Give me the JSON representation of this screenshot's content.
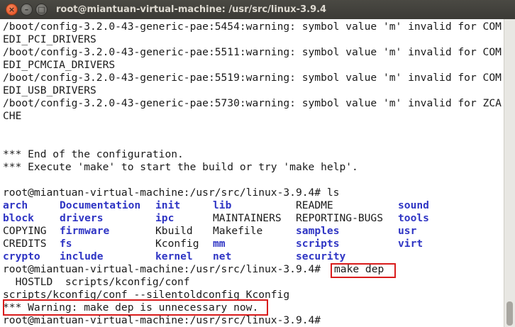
{
  "window": {
    "title": "root@miantuan-virtual-machine: /usr/src/linux-3.9.4",
    "close_glyph": "×",
    "minimize_glyph": "–",
    "maximize_glyph": "□"
  },
  "terminal": {
    "lines": [
      "/boot/config-3.2.0-43-generic-pae:5454:warning: symbol value 'm' invalid for COM",
      "EDI_PCI_DRIVERS",
      "/boot/config-3.2.0-43-generic-pae:5511:warning: symbol value 'm' invalid for COM",
      "EDI_PCMCIA_DRIVERS",
      "/boot/config-3.2.0-43-generic-pae:5519:warning: symbol value 'm' invalid for COM",
      "EDI_USB_DRIVERS",
      "/boot/config-3.2.0-43-generic-pae:5730:warning: symbol value 'm' invalid for ZCA",
      "CHE",
      "",
      "",
      "*** End of the configuration.",
      "*** Execute 'make' to start the build or try 'make help'.",
      "",
      "root@miantuan-virtual-machine:/usr/src/linux-3.9.4# ls"
    ],
    "ls_rows": [
      [
        {
          "t": "arch",
          "d": true
        },
        {
          "t": "Documentation",
          "d": true
        },
        {
          "t": "init",
          "d": true
        },
        {
          "t": "lib",
          "d": true
        },
        {
          "t": "README",
          "d": false
        },
        {
          "t": "sound",
          "d": true
        }
      ],
      [
        {
          "t": "block",
          "d": true
        },
        {
          "t": "drivers",
          "d": true
        },
        {
          "t": "ipc",
          "d": true
        },
        {
          "t": "MAINTAINERS",
          "d": false
        },
        {
          "t": "REPORTING-BUGS",
          "d": false
        },
        {
          "t": "tools",
          "d": true
        }
      ],
      [
        {
          "t": "COPYING",
          "d": false
        },
        {
          "t": "firmware",
          "d": true
        },
        {
          "t": "Kbuild",
          "d": false
        },
        {
          "t": "Makefile",
          "d": false
        },
        {
          "t": "samples",
          "d": true
        },
        {
          "t": "usr",
          "d": true
        }
      ],
      [
        {
          "t": "CREDITS",
          "d": false
        },
        {
          "t": "fs",
          "d": true
        },
        {
          "t": "Kconfig",
          "d": false
        },
        {
          "t": "mm",
          "d": true
        },
        {
          "t": "scripts",
          "d": true
        },
        {
          "t": "virt",
          "d": true
        }
      ],
      [
        {
          "t": "crypto",
          "d": true
        },
        {
          "t": "include",
          "d": true
        },
        {
          "t": "kernel",
          "d": true
        },
        {
          "t": "net",
          "d": true
        },
        {
          "t": "security",
          "d": true
        },
        {
          "t": "",
          "d": false
        }
      ]
    ],
    "prompt": "root@miantuan-virtual-machine:/usr/src/linux-3.9.4#",
    "command": "make dep",
    "output_lines": [
      "  HOSTLD  scripts/kconfig/conf",
      "scripts/kconfig/conf --silentoldconfig Kconfig",
      "*** Warning: make dep is unnecessary now.",
      "root@miantuan-virtual-machine:/usr/src/linux-3.9.4#"
    ]
  },
  "colors": {
    "text": "#1a1a1a",
    "directory": "#2f35c4",
    "highlight_box": "#d91c1c",
    "background": "#ffffff",
    "titlebar": "#3b3a36"
  }
}
